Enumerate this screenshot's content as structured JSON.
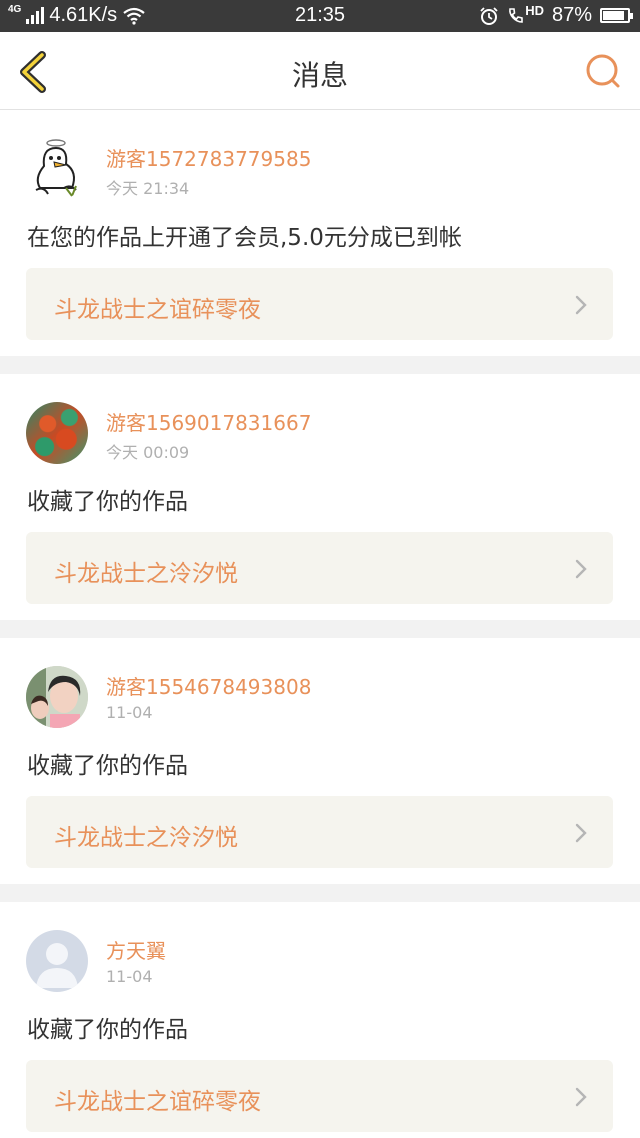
{
  "status_bar": {
    "network": "4G",
    "speed": "4.61K/s",
    "time": "21:35",
    "battery": "87%",
    "battery_level": 0.87,
    "icons": [
      "signal-icon",
      "wifi-icon",
      "alarm-icon",
      "volte-hd-icon",
      "battery-icon"
    ]
  },
  "header": {
    "title": "消息",
    "back_icon": "chevron-left-icon",
    "search_icon": "search-icon",
    "accent_color": "#e8915a"
  },
  "messages": [
    {
      "username": "游客1572783779585",
      "time": "今天 21:34",
      "text": "在您的作品上开通了会员,5.0元分成已到帐",
      "work_title": "斗龙战士之谊碎零夜",
      "avatar": "cartoon-bird-avatar"
    },
    {
      "username": "游客1569017831667",
      "time": "今天 00:09",
      "text": "收藏了你的作品",
      "work_title": "斗龙战士之泠汐悦",
      "avatar": "colorful-pattern-avatar"
    },
    {
      "username": "游客1554678493808",
      "time": "11-04",
      "text": "收藏了你的作品",
      "work_title": "斗龙战士之泠汐悦",
      "avatar": "photo-avatar"
    },
    {
      "username": "方天翼",
      "time": "11-04",
      "text": "收藏了你的作品",
      "work_title": "斗龙战士之谊碎零夜",
      "avatar": "default-user-avatar"
    }
  ]
}
